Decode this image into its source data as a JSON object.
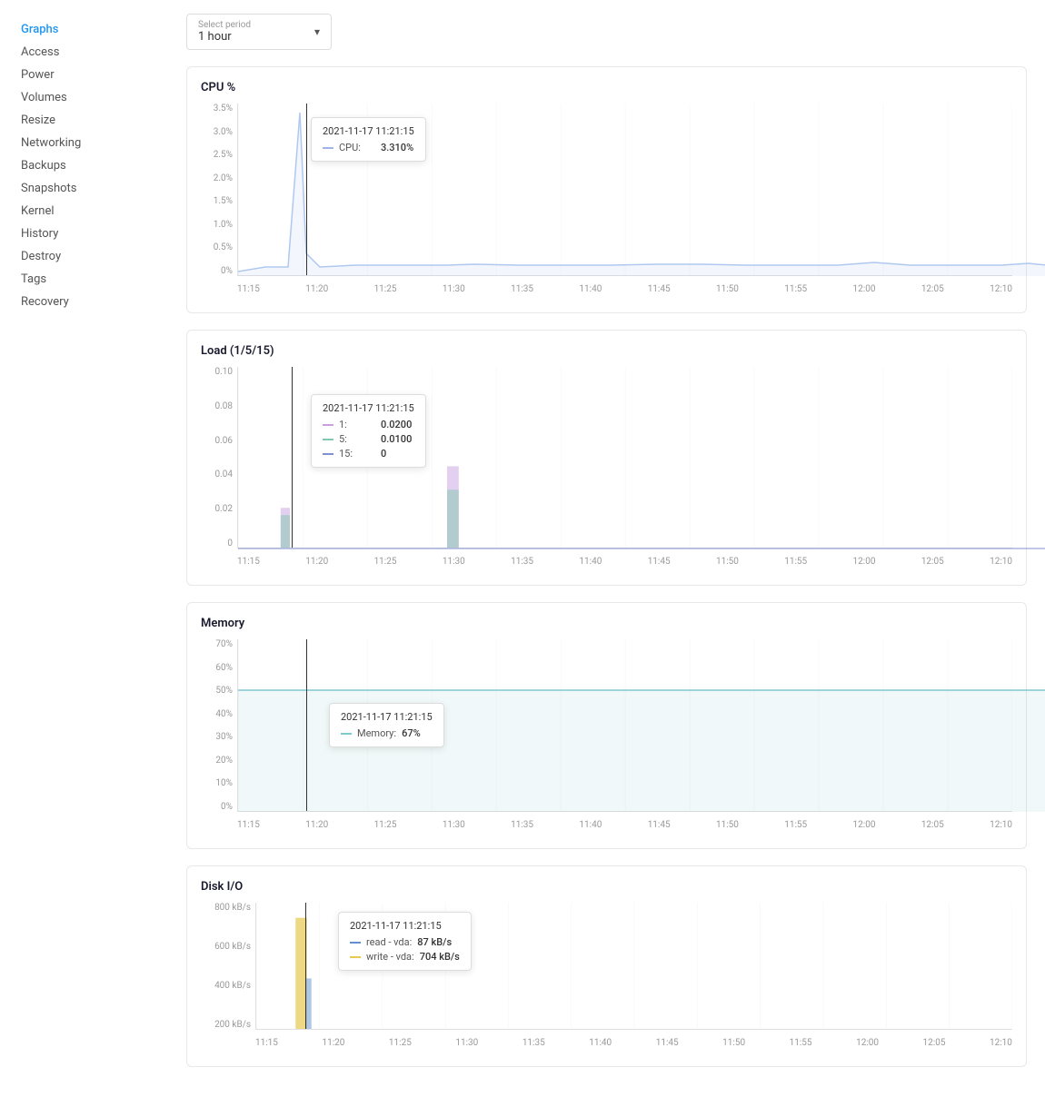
{
  "sidebar": {
    "items": [
      {
        "label": "Graphs",
        "active": true
      },
      {
        "label": "Access",
        "active": false
      },
      {
        "label": "Power",
        "active": false
      },
      {
        "label": "Volumes",
        "active": false
      },
      {
        "label": "Resize",
        "active": false
      },
      {
        "label": "Networking",
        "active": false
      },
      {
        "label": "Backups",
        "active": false
      },
      {
        "label": "Snapshots",
        "active": false
      },
      {
        "label": "Kernel",
        "active": false
      },
      {
        "label": "History",
        "active": false
      },
      {
        "label": "Destroy",
        "active": false
      },
      {
        "label": "Tags",
        "active": false
      },
      {
        "label": "Recovery",
        "active": false
      }
    ]
  },
  "period_selector": {
    "label": "Select period",
    "value": "1 hour"
  },
  "cpu_chart": {
    "title": "CPU %",
    "y_labels": [
      "3.5%",
      "3.0%",
      "2.5%",
      "2.0%",
      "1.5%",
      "1.0%",
      "0.5%",
      "0%"
    ],
    "x_labels": [
      "11:15",
      "11:20",
      "11:25",
      "11:30",
      "11:35",
      "11:40",
      "11:45",
      "11:50",
      "11:55",
      "12:00",
      "12:05",
      "12:10"
    ],
    "tooltip": {
      "time": "2021-11-17 11:21:15",
      "rows": [
        {
          "color": "#a0b4e8",
          "label": "CPU:",
          "value": "3.310%"
        }
      ]
    }
  },
  "load_chart": {
    "title": "Load (1/5/15)",
    "y_labels": [
      "0.10",
      "0.08",
      "0.06",
      "0.04",
      "0.02",
      "0"
    ],
    "x_labels": [
      "11:15",
      "11:20",
      "11:25",
      "11:30",
      "11:35",
      "11:40",
      "11:45",
      "11:50",
      "11:55",
      "12:00",
      "12:05",
      "12:10"
    ],
    "tooltip": {
      "time": "2021-11-17 11:21:15",
      "rows": [
        {
          "color": "#c8a0e0",
          "label": "1:",
          "value": "0.0200"
        },
        {
          "color": "#80c8b0",
          "label": "5:",
          "value": "0.0100"
        },
        {
          "color": "#8090d0",
          "label": "15:",
          "value": "0"
        }
      ]
    }
  },
  "memory_chart": {
    "title": "Memory",
    "y_labels": [
      "70%",
      "60%",
      "50%",
      "40%",
      "30%",
      "20%",
      "10%",
      "0%"
    ],
    "x_labels": [
      "11:15",
      "11:20",
      "11:25",
      "11:30",
      "11:35",
      "11:40",
      "11:45",
      "11:50",
      "11:55",
      "12:00",
      "12:05",
      "12:10"
    ],
    "tooltip": {
      "time": "2021-11-17 11:21:15",
      "rows": [
        {
          "color": "#80c8d0",
          "label": "Memory:",
          "value": "67%"
        }
      ]
    }
  },
  "disk_chart": {
    "title": "Disk I/O",
    "y_labels": [
      "800 kB/s",
      "600 kB/s",
      "400 kB/s",
      "200 kB/s"
    ],
    "x_labels": [
      "11:15",
      "11:20",
      "11:25",
      "11:30",
      "11:35",
      "11:40",
      "11:45",
      "11:50",
      "11:55",
      "12:00",
      "12:05",
      "12:10"
    ],
    "tooltip": {
      "time": "2021-11-17 11:21:15",
      "rows": [
        {
          "color": "#6090d0",
          "label": "read - vda:",
          "value": "87 kB/s"
        },
        {
          "color": "#e8c850",
          "label": "write - vda:",
          "value": "704 kB/s"
        }
      ]
    }
  }
}
